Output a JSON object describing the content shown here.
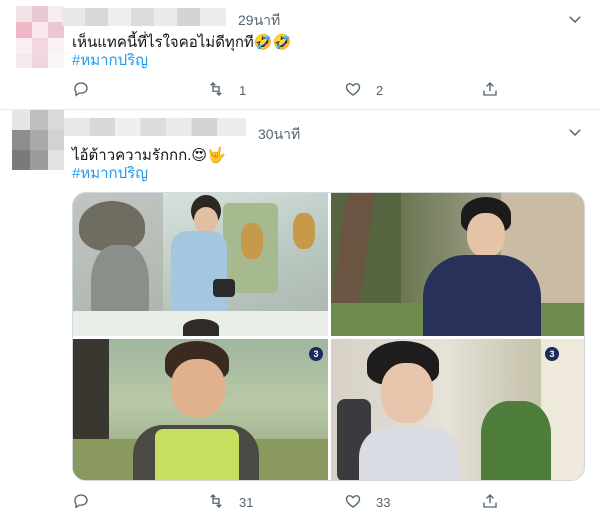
{
  "tweets": [
    {
      "time": "29นาที",
      "text": "เห็นแทคนี้ที่ไรใจคอไม่ดีทุกที🤣🤣",
      "hashtag": "#หมากปริญ",
      "actions": {
        "reply": "",
        "retweet": "1",
        "like": "2"
      }
    },
    {
      "time": "30นาที",
      "text": "ไอ้ต้าวความรักกก.😍🤟",
      "hashtag": "#หมากปริญ",
      "actions": {
        "reply": "",
        "retweet": "31",
        "like": "33"
      }
    }
  ],
  "icons": {
    "reply": "reply-icon",
    "retweet": "retweet-icon",
    "like": "heart-icon",
    "share": "share-icon",
    "caret": "chevron-down-icon"
  },
  "colors": {
    "hashtag": "#1d9bf0",
    "secondary_text": "#536471",
    "divider": "#e6ecf0"
  }
}
